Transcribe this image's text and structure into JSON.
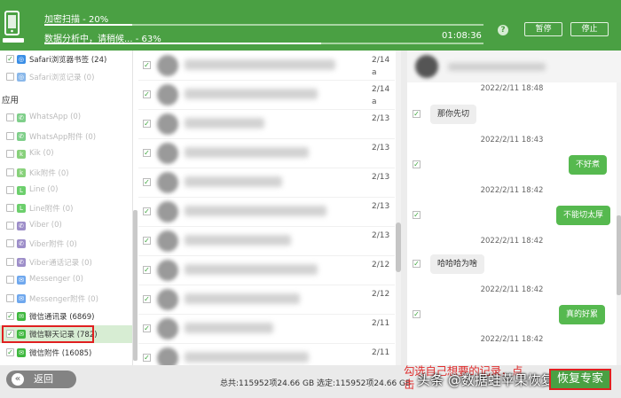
{
  "header": {
    "title": "",
    "scan_label": "加密扫描 - 20%",
    "scan_progress": 0.2,
    "analysis_label": "数据分析中，请稍候... - 63%",
    "analysis_progress": 0.63,
    "elapsed": "01:08:36",
    "help": "?",
    "pause_label": "暂停",
    "stop_label": "停止"
  },
  "sidebar": {
    "section_apps": "应用",
    "items": [
      {
        "label": "Safari浏览器书签 (24)",
        "checked": true,
        "icon": "safari-icon",
        "color": "#3a8ee6",
        "active": true
      },
      {
        "label": "Safari浏览记录 (0)",
        "checked": false,
        "icon": "safari-icon",
        "color": "#8ab8ea",
        "active": false
      },
      {
        "label": "WhatsApp (0)",
        "checked": false,
        "icon": "whatsapp-icon",
        "color": "#7fcf8a",
        "active": false
      },
      {
        "label": "WhatsApp附件 (0)",
        "checked": false,
        "icon": "whatsapp-icon",
        "color": "#7fcf8a",
        "active": false
      },
      {
        "label": "Kik (0)",
        "checked": false,
        "icon": "kik-icon",
        "color": "#88d17b",
        "active": false
      },
      {
        "label": "Kik附件 (0)",
        "checked": false,
        "icon": "kik-icon",
        "color": "#88d17b",
        "active": false
      },
      {
        "label": "Line (0)",
        "checked": false,
        "icon": "line-icon",
        "color": "#6ccf6c",
        "active": false
      },
      {
        "label": "Line附件 (0)",
        "checked": false,
        "icon": "line-icon",
        "color": "#6ccf6c",
        "active": false
      },
      {
        "label": "Viber (0)",
        "checked": false,
        "icon": "viber-icon",
        "color": "#9d8ec9",
        "active": false
      },
      {
        "label": "Viber附件 (0)",
        "checked": false,
        "icon": "viber-icon",
        "color": "#9d8ec9",
        "active": false
      },
      {
        "label": "Viber通话记录 (0)",
        "checked": false,
        "icon": "viber-icon",
        "color": "#9d8ec9",
        "active": false
      },
      {
        "label": "Messenger (0)",
        "checked": false,
        "icon": "messenger-icon",
        "color": "#6fa8ee",
        "active": false
      },
      {
        "label": "Messenger附件 (0)",
        "checked": false,
        "icon": "messenger-icon",
        "color": "#6fa8ee",
        "active": false
      },
      {
        "label": "微信通讯录 (6869)",
        "checked": true,
        "icon": "wechat-icon",
        "color": "#3fb83f",
        "active": true
      },
      {
        "label": "微信聊天记录 (782)",
        "checked": true,
        "icon": "wechat-icon",
        "color": "#3fb83f",
        "active": true,
        "selected": true
      },
      {
        "label": "微信附件 (16085)",
        "checked": true,
        "icon": "wechat-icon",
        "color": "#3fb83f",
        "active": true
      }
    ]
  },
  "messages": {
    "rows": [
      {
        "checked": true,
        "date": "2/14",
        "date2": "a"
      },
      {
        "checked": true,
        "date": "2/14",
        "date2": "a"
      },
      {
        "checked": true,
        "date": "2/13",
        "date2": ""
      },
      {
        "checked": true,
        "date": "2/13",
        "date2": ""
      },
      {
        "checked": true,
        "date": "2/13",
        "date2": ""
      },
      {
        "checked": true,
        "date": "2/13",
        "date2": ""
      },
      {
        "checked": true,
        "date": "2/13",
        "date2": ""
      },
      {
        "checked": true,
        "date": "2/12",
        "date2": ""
      },
      {
        "checked": true,
        "date": "2/12",
        "date2": ""
      },
      {
        "checked": true,
        "date": "2/11",
        "date2": ""
      },
      {
        "checked": true,
        "date": "2/11",
        "date2": ""
      }
    ]
  },
  "detail": {
    "entries": [
      {
        "time": "2022/2/11 18:48",
        "text": "那你先切",
        "dir": "in"
      },
      {
        "time": "2022/2/11 18:43",
        "text": "不好煮",
        "dir": "out"
      },
      {
        "time": "2022/2/11 18:42",
        "text": "不能切太厚",
        "dir": "out"
      },
      {
        "time": "2022/2/11 18:42",
        "text": "哈哈哈为啥",
        "dir": "in"
      },
      {
        "time": "2022/2/11 18:42",
        "text": "真的好累",
        "dir": "out"
      },
      {
        "time": "2022/2/11 18:42",
        "text": "",
        "dir": "out"
      }
    ],
    "first_time": "2022/2/11 18:48"
  },
  "footer": {
    "back_label": "返回",
    "totals": "总共:115952项24.66 GB 选定:115952项24.66 GB",
    "instruction_line1": "勾选自己想要的记录，点",
    "instruction_line2": "击",
    "watermark": "头条 @数据蛙苹果恢复专家",
    "recover_label": "恢复专家"
  }
}
